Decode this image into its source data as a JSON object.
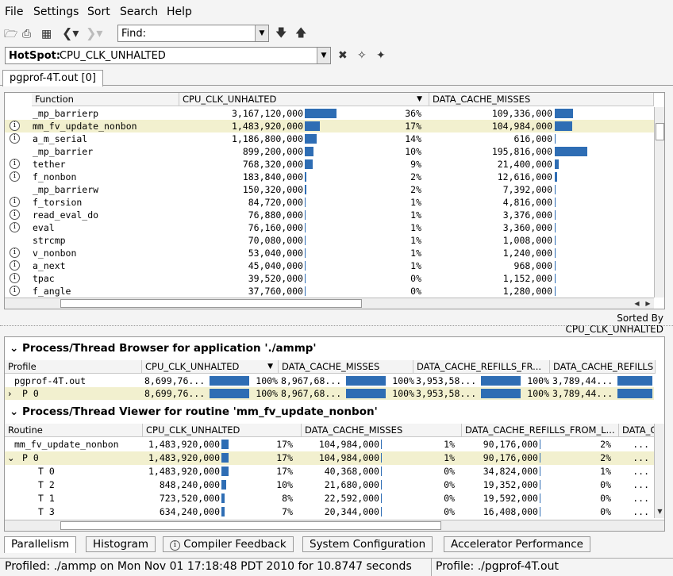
{
  "menu": [
    "File",
    "Settings",
    "Sort",
    "Search",
    "Help"
  ],
  "toolbar": {
    "find_label": "Find:",
    "find_value": "",
    "hotspot_label": "HotSpot:",
    "hotspot_value": "CPU_CLK_UNHALTED"
  },
  "tab": {
    "label": "pgprof-4T.out [0]"
  },
  "hotspot_table": {
    "headers": [
      "Function",
      "CPU_CLK_UNHALTED",
      "DATA_CACHE_MISSES"
    ],
    "rows": [
      {
        "info": false,
        "name": "_mp_barrierp",
        "cpu": "3,167,120,000",
        "cpu_pct": "36%",
        "cpu_bar": 0.36,
        "dcm": "109,336,000",
        "dcm_bar": 0.5
      },
      {
        "info": true,
        "name": "mm_fv_update_nonbon",
        "cpu": "1,483,920,000",
        "cpu_pct": "17%",
        "cpu_bar": 0.17,
        "dcm": "104,984,000",
        "dcm_bar": 0.48,
        "selected": true
      },
      {
        "info": true,
        "name": "a_m_serial",
        "cpu": "1,186,800,000",
        "cpu_pct": "14%",
        "cpu_bar": 0.14,
        "dcm": "616,000",
        "dcm_bar": 0.0
      },
      {
        "info": false,
        "name": "_mp_barrier",
        "cpu": "899,200,000",
        "cpu_pct": "10%",
        "cpu_bar": 0.1,
        "dcm": "195,816,000",
        "dcm_bar": 0.9
      },
      {
        "info": true,
        "name": "tether",
        "cpu": "768,320,000",
        "cpu_pct": "9%",
        "cpu_bar": 0.09,
        "dcm": "21,400,000",
        "dcm_bar": 0.1
      },
      {
        "info": true,
        "name": "f_nonbon",
        "cpu": "183,840,000",
        "cpu_pct": "2%",
        "cpu_bar": 0.02,
        "dcm": "12,616,000",
        "dcm_bar": 0.06
      },
      {
        "info": false,
        "name": "_mp_barrierw",
        "cpu": "150,320,000",
        "cpu_pct": "2%",
        "cpu_bar": 0.02,
        "dcm": "7,392,000",
        "dcm_bar": 0.03
      },
      {
        "info": true,
        "name": "f_torsion",
        "cpu": "84,720,000",
        "cpu_pct": "1%",
        "cpu_bar": 0.01,
        "dcm": "4,816,000",
        "dcm_bar": 0.02
      },
      {
        "info": true,
        "name": "read_eval_do",
        "cpu": "76,880,000",
        "cpu_pct": "1%",
        "cpu_bar": 0.01,
        "dcm": "3,376,000",
        "dcm_bar": 0.015
      },
      {
        "info": true,
        "name": "eval",
        "cpu": "76,160,000",
        "cpu_pct": "1%",
        "cpu_bar": 0.01,
        "dcm": "3,360,000",
        "dcm_bar": 0.015
      },
      {
        "info": false,
        "name": "strcmp",
        "cpu": "70,080,000",
        "cpu_pct": "1%",
        "cpu_bar": 0.01,
        "dcm": "1,008,000",
        "dcm_bar": 0.0
      },
      {
        "info": true,
        "name": "v_nonbon",
        "cpu": "53,040,000",
        "cpu_pct": "1%",
        "cpu_bar": 0.01,
        "dcm": "1,240,000",
        "dcm_bar": 0.0
      },
      {
        "info": true,
        "name": "a_next",
        "cpu": "45,040,000",
        "cpu_pct": "1%",
        "cpu_bar": 0.01,
        "dcm": "968,000",
        "dcm_bar": 0.0
      },
      {
        "info": true,
        "name": "tpac",
        "cpu": "39,520,000",
        "cpu_pct": "0%",
        "cpu_bar": 0.0,
        "dcm": "1,152,000",
        "dcm_bar": 0.0
      },
      {
        "info": true,
        "name": "f_angle",
        "cpu": "37,760,000",
        "cpu_pct": "0%",
        "cpu_bar": 0.0,
        "dcm": "1,280,000",
        "dcm_bar": 0.0
      }
    ],
    "sorted_by": "Sorted By CPU_CLK_UNHALTED"
  },
  "browser": {
    "title": "Process/Thread Browser for application './ammp'",
    "headers": [
      "Profile",
      "CPU_CLK_UNHALTED",
      "DATA_CACHE_MISSES",
      "DATA_CACHE_REFILLS_FR...",
      "DATA_CACHE_REFILLS"
    ],
    "rows": [
      {
        "name": "pgprof-4T.out",
        "c1": "8,699,76...",
        "c2": "8,967,68...",
        "c3": "3,953,58...",
        "c4": "3,789,44...",
        "pct": "100%"
      },
      {
        "name": "P 0",
        "c1": "8,699,76...",
        "c2": "8,967,68...",
        "c3": "3,953,58...",
        "c4": "3,789,44...",
        "pct": "100%",
        "selected": true
      }
    ]
  },
  "viewer": {
    "title": "Process/Thread Viewer for routine 'mm_fv_update_nonbon'",
    "headers": [
      "Routine",
      "CPU_CLK_UNHALTED",
      "DATA_CACHE_MISSES",
      "DATA_CACHE_REFILLS_FROM_L...",
      "DATA_C"
    ],
    "rows": [
      {
        "name": "mm_fv_update_nonbon",
        "indent": 0,
        "cpu": "1,483,920,000",
        "cpu_pct": "17%",
        "cpu_bar": 0.17,
        "dcm": "104,984,000",
        "dcm_pct": "1%",
        "ref": "90,176,000",
        "ref_pct": "2%",
        "last": "..."
      },
      {
        "name": "P 0",
        "indent": 1,
        "cpu": "1,483,920,000",
        "cpu_pct": "17%",
        "cpu_bar": 0.17,
        "dcm": "104,984,000",
        "dcm_pct": "1%",
        "ref": "90,176,000",
        "ref_pct": "2%",
        "last": "...",
        "selected": true
      },
      {
        "name": "T 0",
        "indent": 2,
        "cpu": "1,483,920,000",
        "cpu_pct": "17%",
        "cpu_bar": 0.17,
        "dcm": "40,368,000",
        "dcm_pct": "0%",
        "ref": "34,824,000",
        "ref_pct": "1%",
        "last": "..."
      },
      {
        "name": "T 2",
        "indent": 2,
        "cpu": "848,240,000",
        "cpu_pct": "10%",
        "cpu_bar": 0.1,
        "dcm": "21,680,000",
        "dcm_pct": "0%",
        "ref": "19,352,000",
        "ref_pct": "0%",
        "last": "..."
      },
      {
        "name": "T 1",
        "indent": 2,
        "cpu": "723,520,000",
        "cpu_pct": "8%",
        "cpu_bar": 0.08,
        "dcm": "22,592,000",
        "dcm_pct": "0%",
        "ref": "19,592,000",
        "ref_pct": "0%",
        "last": "..."
      },
      {
        "name": "T 3",
        "indent": 2,
        "cpu": "634,240,000",
        "cpu_pct": "7%",
        "cpu_bar": 0.07,
        "dcm": "20,344,000",
        "dcm_pct": "0%",
        "ref": "16,408,000",
        "ref_pct": "0%",
        "last": "..."
      }
    ]
  },
  "bottom_tabs": [
    "Parallelism",
    "Histogram",
    "Compiler Feedback",
    "System Configuration",
    "Accelerator Performance"
  ],
  "status": {
    "left": "Profiled: ./ammp on Mon Nov 01 17:18:48 PDT 2010 for 10.8747 seconds",
    "right": "Profile: ./pgprof-4T.out"
  }
}
